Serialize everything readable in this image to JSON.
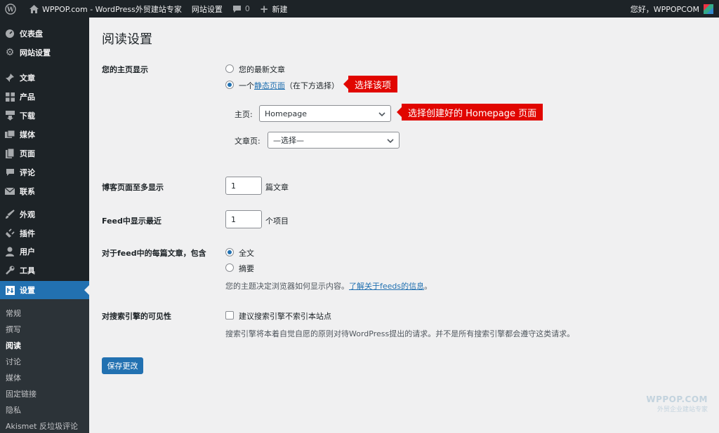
{
  "adminbar": {
    "site_title": "WPPOP.com - WordPress外贸建站专家",
    "site_settings": "网站设置",
    "comments_count": "0",
    "new_label": "新建",
    "greeting": "您好，WPPOPCOM"
  },
  "sidebar": {
    "items": [
      {
        "label": "仪表盘",
        "icon": "dashboard-icon"
      },
      {
        "label": "网站设置",
        "icon": "gear-icon"
      },
      {
        "label": "文章",
        "icon": "pin-icon"
      },
      {
        "label": "产品",
        "icon": "grid-icon"
      },
      {
        "label": "下载",
        "icon": "download-icon"
      },
      {
        "label": "媒体",
        "icon": "media-icon"
      },
      {
        "label": "页面",
        "icon": "page-icon"
      },
      {
        "label": "评论",
        "icon": "comment-icon"
      },
      {
        "label": "联系",
        "icon": "mail-icon"
      },
      {
        "label": "外观",
        "icon": "brush-icon"
      },
      {
        "label": "插件",
        "icon": "plugin-icon"
      },
      {
        "label": "用户",
        "icon": "user-icon"
      },
      {
        "label": "工具",
        "icon": "wrench-icon"
      },
      {
        "label": "设置",
        "icon": "settings-icon"
      }
    ],
    "submenu": [
      "常规",
      "撰写",
      "阅读",
      "讨论",
      "媒体",
      "固定链接",
      "隐私",
      "Akismet 反垃圾评论"
    ]
  },
  "main": {
    "title": "阅读设置",
    "homepage_display": {
      "label": "您的主页显示",
      "option_latest": "您的最新文章",
      "option_static_prefix": "一个",
      "option_static_link": "静态页面",
      "option_static_suffix": "（在下方选择）",
      "homepage_label": "主页:",
      "homepage_value": "Homepage",
      "posts_page_label": "文章页:",
      "posts_page_value": "—选择—"
    },
    "posts_per_page": {
      "label": "博客页面至多显示",
      "value": "1",
      "unit": "篇文章"
    },
    "feed_recent": {
      "label": "Feed中显示最近",
      "value": "1",
      "unit": "个项目"
    },
    "feed_content": {
      "label": "对于feed中的每篇文章，包含",
      "option_full": "全文",
      "option_summary": "摘要",
      "note_prefix": "您的主题决定浏览器如何显示内容。",
      "note_link": "了解关于feeds的信息",
      "note_suffix": "。"
    },
    "search_visibility": {
      "label": "对搜索引擎的可见性",
      "checkbox_label": "建议搜索引擎不索引本站点",
      "note": "搜索引擎将本着自觉自愿的原则对待WordPress提出的请求。并不是所有搜索引擎都会遵守这类请求。"
    },
    "save_button": "保存更改"
  },
  "callouts": {
    "select_item": "选择该项",
    "select_homepage": "选择创建好的 Homepage 页面"
  },
  "watermark": {
    "line1": "WPPOP.COM",
    "line2": "外贸企业建站专家"
  },
  "colors": {
    "accent": "#2271b1",
    "adminbar": "#1d2327",
    "callout": "#e10600"
  }
}
